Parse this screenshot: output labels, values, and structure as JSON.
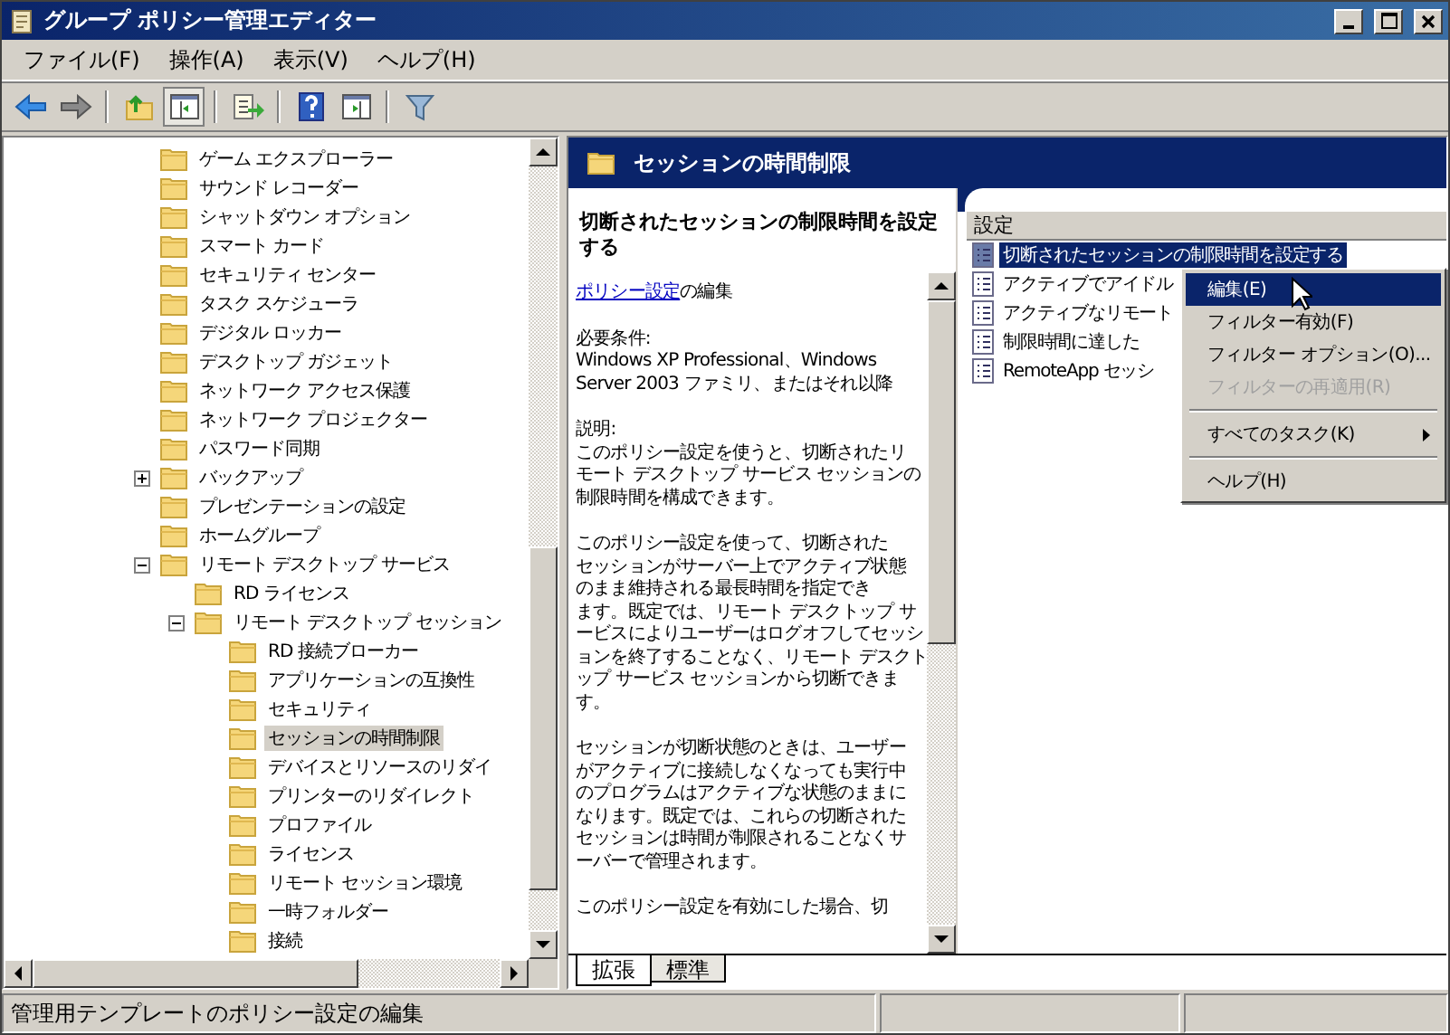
{
  "window": {
    "title": "グループ ポリシー管理エディター"
  },
  "menu": [
    "ファイル(F)",
    "操作(A)",
    "表示(V)",
    "ヘルプ(H)"
  ],
  "toolbar": [
    {
      "kind": "back",
      "pressed": false
    },
    {
      "kind": "forward",
      "pressed": false
    },
    {
      "kind": "sep"
    },
    {
      "kind": "up",
      "pressed": false
    },
    {
      "kind": "tree",
      "pressed": true
    },
    {
      "kind": "sep"
    },
    {
      "kind": "export",
      "pressed": false
    },
    {
      "kind": "sep"
    },
    {
      "kind": "help",
      "pressed": false
    },
    {
      "kind": "pane",
      "pressed": false
    },
    {
      "kind": "sep"
    },
    {
      "kind": "filter",
      "pressed": false
    }
  ],
  "tree": [
    {
      "label": "ゲーム エクスプローラー",
      "selected": false
    },
    {
      "label": "サウンド レコーダー",
      "selected": false
    },
    {
      "label": "シャットダウン オプション",
      "selected": false
    },
    {
      "label": "スマート カード",
      "selected": false
    },
    {
      "label": "セキュリティ センター",
      "selected": false
    },
    {
      "label": "タスク スケジューラ",
      "selected": false
    },
    {
      "label": "デジタル ロッカー",
      "selected": false
    },
    {
      "label": "デスクトップ ガジェット",
      "selected": false
    },
    {
      "label": "ネットワーク アクセス保護",
      "selected": false
    },
    {
      "label": "ネットワーク プロジェクター",
      "selected": false
    },
    {
      "label": "パスワード同期",
      "selected": false
    },
    {
      "label": "バックアップ",
      "selected": false,
      "expanded": false
    },
    {
      "label": "プレゼンテーションの設定",
      "selected": false
    },
    {
      "label": "ホームグループ",
      "selected": false
    },
    {
      "label": "リモート デスクトップ サービス",
      "selected": false,
      "expanded": true,
      "children": [
        {
          "label": "RD ライセンス",
          "selected": false
        },
        {
          "label": "リモート デスクトップ セッション",
          "selected": false,
          "expanded": true,
          "children": [
            {
              "label": "RD 接続ブローカー",
              "selected": false
            },
            {
              "label": "アプリケーションの互換性",
              "selected": false
            },
            {
              "label": "セキュリティ",
              "selected": false
            },
            {
              "label": "セッションの時間制限",
              "selected": true
            },
            {
              "label": "デバイスとリソースのリダイ",
              "selected": false
            },
            {
              "label": "プリンターのリダイレクト",
              "selected": false
            },
            {
              "label": "プロファイル",
              "selected": false
            },
            {
              "label": "ライセンス",
              "selected": false
            },
            {
              "label": "リモート セッション環境",
              "selected": false
            },
            {
              "label": "一時フォルダー",
              "selected": false
            },
            {
              "label": "接続",
              "selected": false
            }
          ]
        }
      ]
    }
  ],
  "header": {
    "title": "セッションの時間制限"
  },
  "description": {
    "title": "切断されたセッションの制限時間を設定する",
    "link": "ポリシー設定",
    "link_after": "の編集",
    "paragraphs": [
      [
        "必要条件:",
        "Windows XP Professional、Windows",
        "Server 2003 ファミリ、またはそれ以降"
      ],
      [
        "説明:",
        "このポリシー設定を使うと、切断されたリ",
        "モート デスクトップ サービス セッションの",
        "制限時間を構成できます。"
      ],
      [
        "このポリシー設定を使って、切断された",
        "セッションがサーバー上でアクティブ状態",
        "のまま維持される最長時間を指定でき",
        "ます。既定では、リモート デスクトップ サ",
        "ービスによりユーザーはログオフしてセッシ",
        "ョンを終了することなく、リモート デスクト",
        "ップ サービス セッションから切断できま",
        "す。"
      ],
      [
        "セッションが切断状態のときは、ユーザー",
        "がアクティブに接続しなくなっても実行中",
        "のプログラムはアクティブな状態のままに",
        "なります。既定では、これらの切断された",
        "セッションは時間が制限されることなくサ",
        "ーバーで管理されます。"
      ],
      [
        "このポリシー設定を有効にした場合、切"
      ]
    ]
  },
  "list": {
    "column": "設定",
    "rows": [
      {
        "label": "切断されたセッションの制限時間を設定する",
        "selected": true
      },
      {
        "label": "アクティブでアイドル",
        "selected": false
      },
      {
        "label": "アクティブなリモート",
        "selected": false
      },
      {
        "label": "制限時間に達した",
        "selected": false
      },
      {
        "label": "RemoteApp セッシ",
        "selected": false
      }
    ]
  },
  "context_menu": [
    {
      "kind": "item",
      "label": "編集(E)",
      "selected": true,
      "disabled": false
    },
    {
      "kind": "item",
      "label": "フィルター有効(F)",
      "selected": false,
      "disabled": false
    },
    {
      "kind": "item",
      "label": "フィルター オプション(O)...",
      "selected": false,
      "disabled": false
    },
    {
      "kind": "item",
      "label": "フィルターの再適用(R)",
      "selected": false,
      "disabled": true
    },
    {
      "kind": "separator"
    },
    {
      "kind": "submenu",
      "label": "すべてのタスク(K)",
      "selected": false,
      "disabled": false
    },
    {
      "kind": "separator"
    },
    {
      "kind": "item",
      "label": "ヘルプ(H)",
      "selected": false,
      "disabled": false
    }
  ],
  "tabs": [
    {
      "label": "拡張",
      "selected": true
    },
    {
      "label": "標準",
      "selected": false
    }
  ],
  "status_bar": {
    "text": "管理用テンプレートのポリシー設定の編集"
  }
}
